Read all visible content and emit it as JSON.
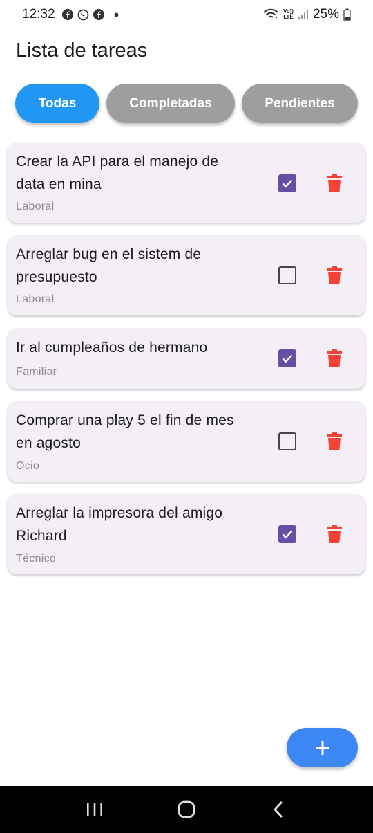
{
  "status_bar": {
    "time": "12:32",
    "battery": "25%",
    "lte_top": "Vo))",
    "lte_bottom": "LTE"
  },
  "header": {
    "title": "Lista de tareas"
  },
  "filters": {
    "all": "Todas",
    "completed": "Completadas",
    "pending": "Pendientes"
  },
  "tasks": [
    {
      "title": "Crear la API para el manejo de data en mina",
      "category": "Laboral",
      "done": true
    },
    {
      "title": "Arreglar bug en el sistem de presupuesto",
      "category": "Laboral",
      "done": false
    },
    {
      "title": "Ir al cumpleaños de hermano",
      "category": "Familiar",
      "done": true
    },
    {
      "title": "Comprar una play 5 el fin de mes en agosto",
      "category": "Ocio",
      "done": false
    },
    {
      "title": "Arreglar la impresora del amigo Richard",
      "category": "Técnico",
      "done": true
    }
  ],
  "fab": {
    "icon": "plus-icon"
  },
  "colors": {
    "accent": "#2196f3",
    "inactive_filter": "#9e9e9e",
    "checkbox": "#6750a4",
    "delete": "#f44336",
    "card": "#f4eff7",
    "fab": "#3d87f5"
  }
}
